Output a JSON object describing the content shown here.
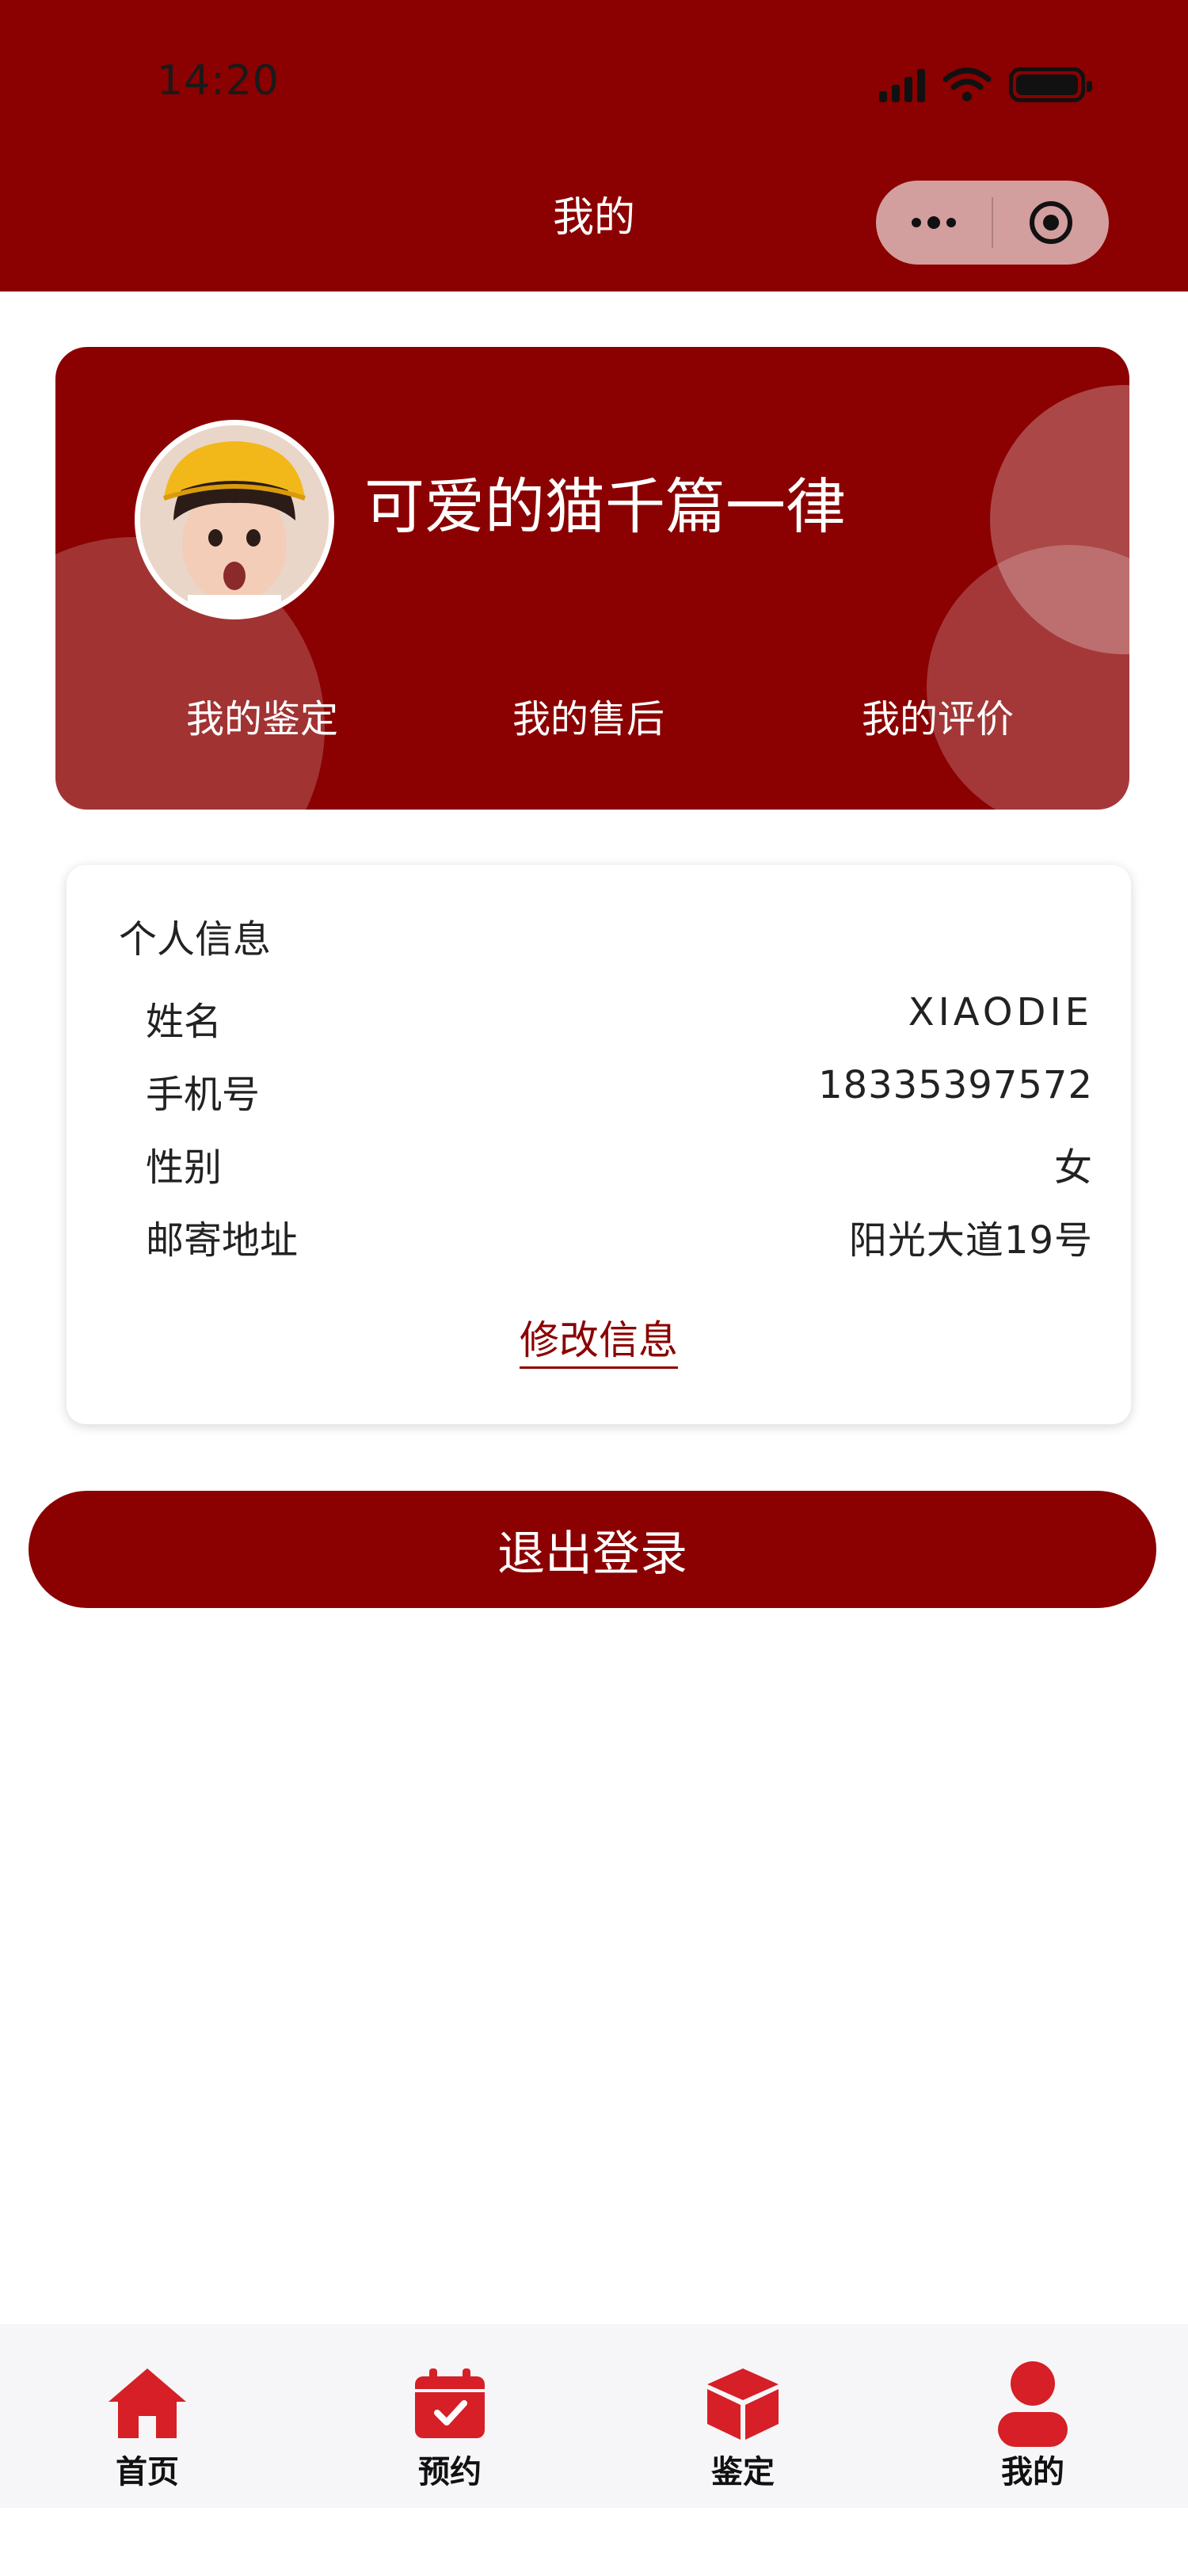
{
  "status_bar": {
    "time": "14:20"
  },
  "header": {
    "title": "我的"
  },
  "profile": {
    "nickname": "可爱的猫千篇一律",
    "links": [
      "我的鉴定",
      "我的售后",
      "我的评价"
    ]
  },
  "info": {
    "title": "个人信息",
    "rows": [
      {
        "label": "姓名",
        "value": "XIAODIE"
      },
      {
        "label": "手机号",
        "value": "18335397572"
      },
      {
        "label": "性别",
        "value": "女"
      },
      {
        "label": "邮寄地址",
        "value": "阳光大道19号"
      }
    ],
    "edit_label": "修改信息"
  },
  "logout_label": "退出登录",
  "tabbar": {
    "tabs": [
      {
        "label": "首页",
        "icon": "home-icon"
      },
      {
        "label": "预约",
        "icon": "calendar-check-icon"
      },
      {
        "label": "鉴定",
        "icon": "box-icon"
      },
      {
        "label": "我的",
        "icon": "user-icon"
      }
    ]
  },
  "colors": {
    "primary": "#8b0000",
    "tab_icon": "#d61f26"
  }
}
